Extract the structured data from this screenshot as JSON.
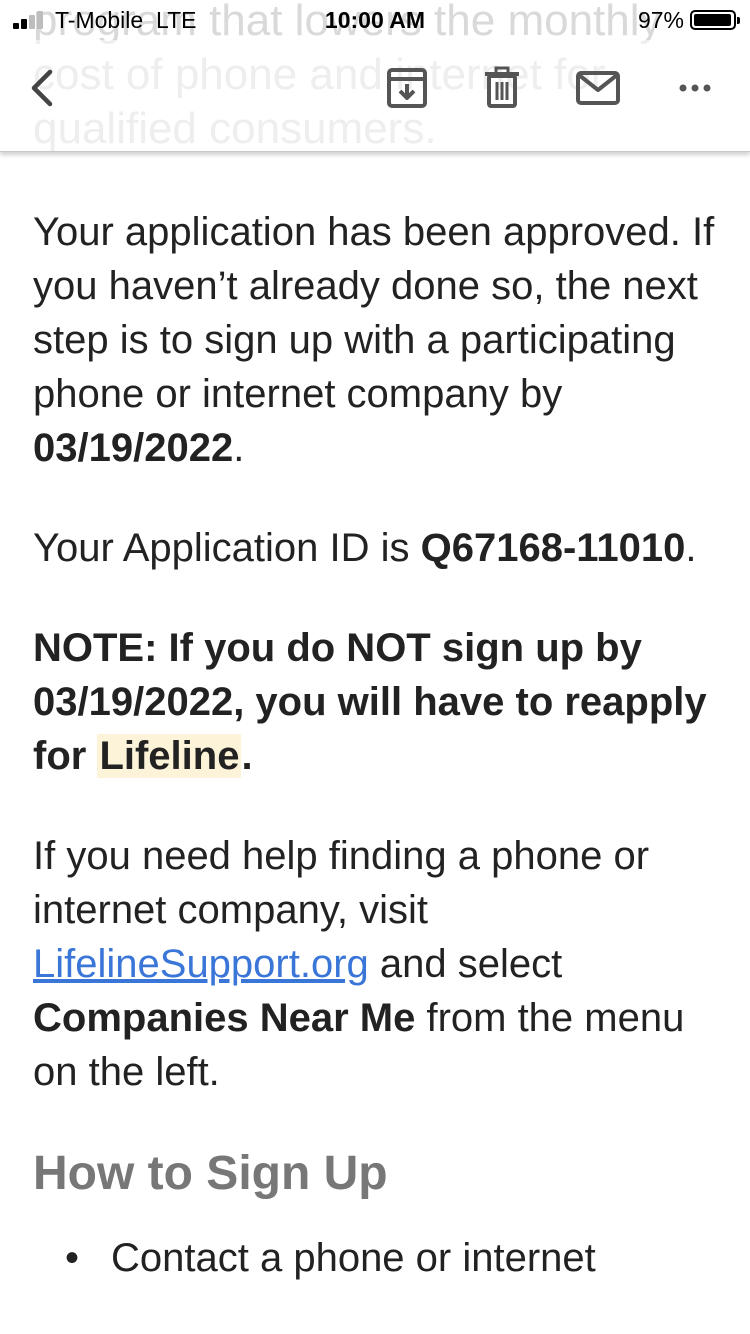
{
  "status_bar": {
    "carrier": "T-Mobile",
    "network": "LTE",
    "time": "10:00 AM",
    "battery": "97%",
    "battery_level": 0.97,
    "signal_bars": 2
  },
  "underlay_text": "program that lowers the monthly cost of phone and internet for qualified consumers.",
  "toolbar": {
    "back_icon": "chevron-left-icon",
    "archive_icon": "archive-icon",
    "trash_icon": "trash-icon",
    "mail_icon": "mail-icon",
    "more_icon": "more-horizontal-icon"
  },
  "email": {
    "p1_text": "Your application has been approved. If you haven’t already done so, the next step is to sign up with a participating phone or internet company by ",
    "p1_date": "03/19/2022",
    "p1_end": ".",
    "p2_text": "Your Application ID is ",
    "p2_id": "Q67168-11010",
    "p2_end": ".",
    "note_text": "NOTE: If you do NOT sign up by 03/19/2022, you will have to reapply for ",
    "note_highlight": "Lifeline",
    "note_end": ".",
    "p4_text": "If you need help finding a phone or internet company, visit ",
    "p4_link": "LifelineSupport.org",
    "p4_mid": " and select ",
    "p4_bold": "Companies Near Me",
    "p4_end": " from the menu on the left.",
    "heading": "How to Sign Up",
    "bullet_1": "Contact a phone or internet"
  },
  "colors": {
    "link": "#3a76d8",
    "highlight": "#fcf3d9",
    "heading": "#777777"
  }
}
